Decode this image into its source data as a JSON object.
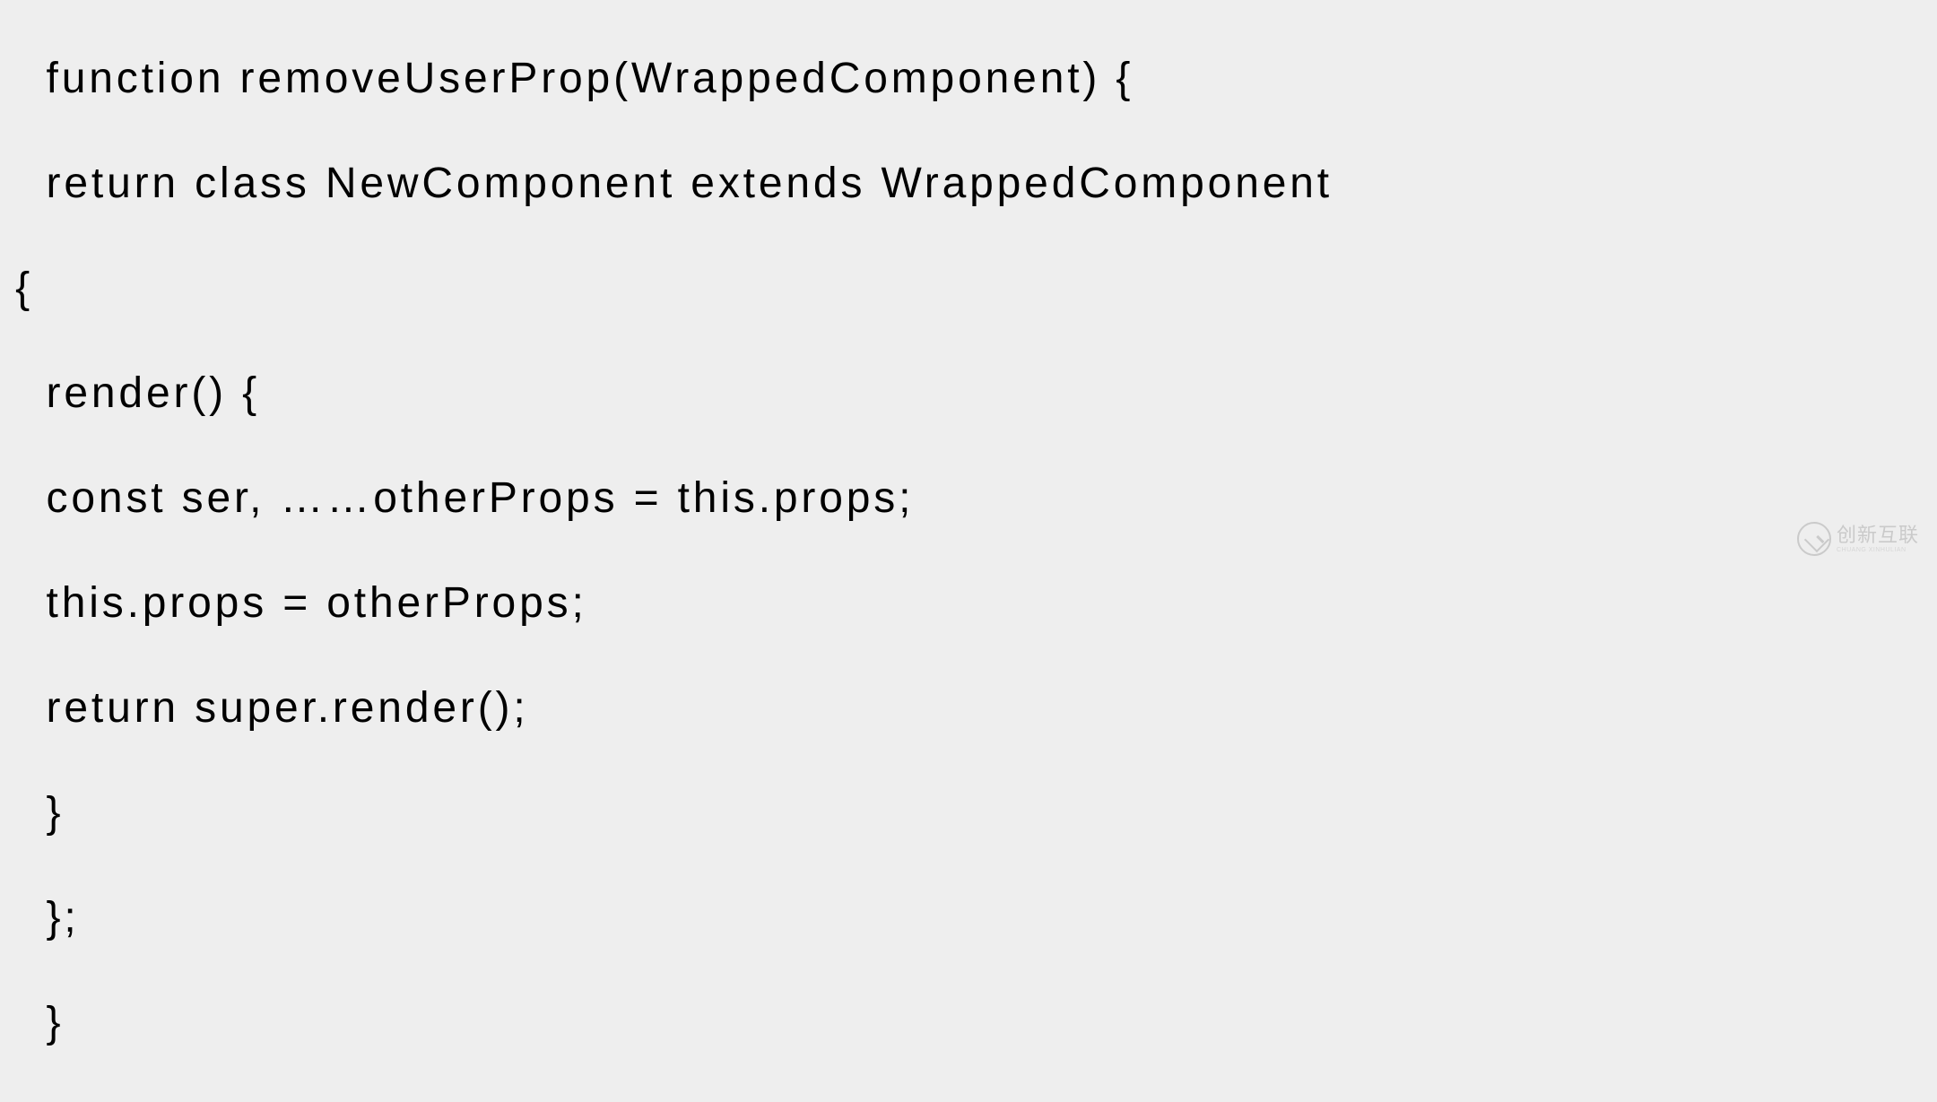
{
  "code": {
    "lines": [
      "   function removeUserProp(WrappedComponent) {",
      "   return class NewComponent extends WrappedComponent",
      " {",
      "   render() {",
      "   const ser, ……otherProps = this.props;",
      "   this.props = otherProps;",
      "   return super.render();",
      "   }",
      "   };",
      "   }"
    ]
  },
  "watermark": {
    "main": "创新互联",
    "sub": "CHUANG XINHULIAN"
  }
}
